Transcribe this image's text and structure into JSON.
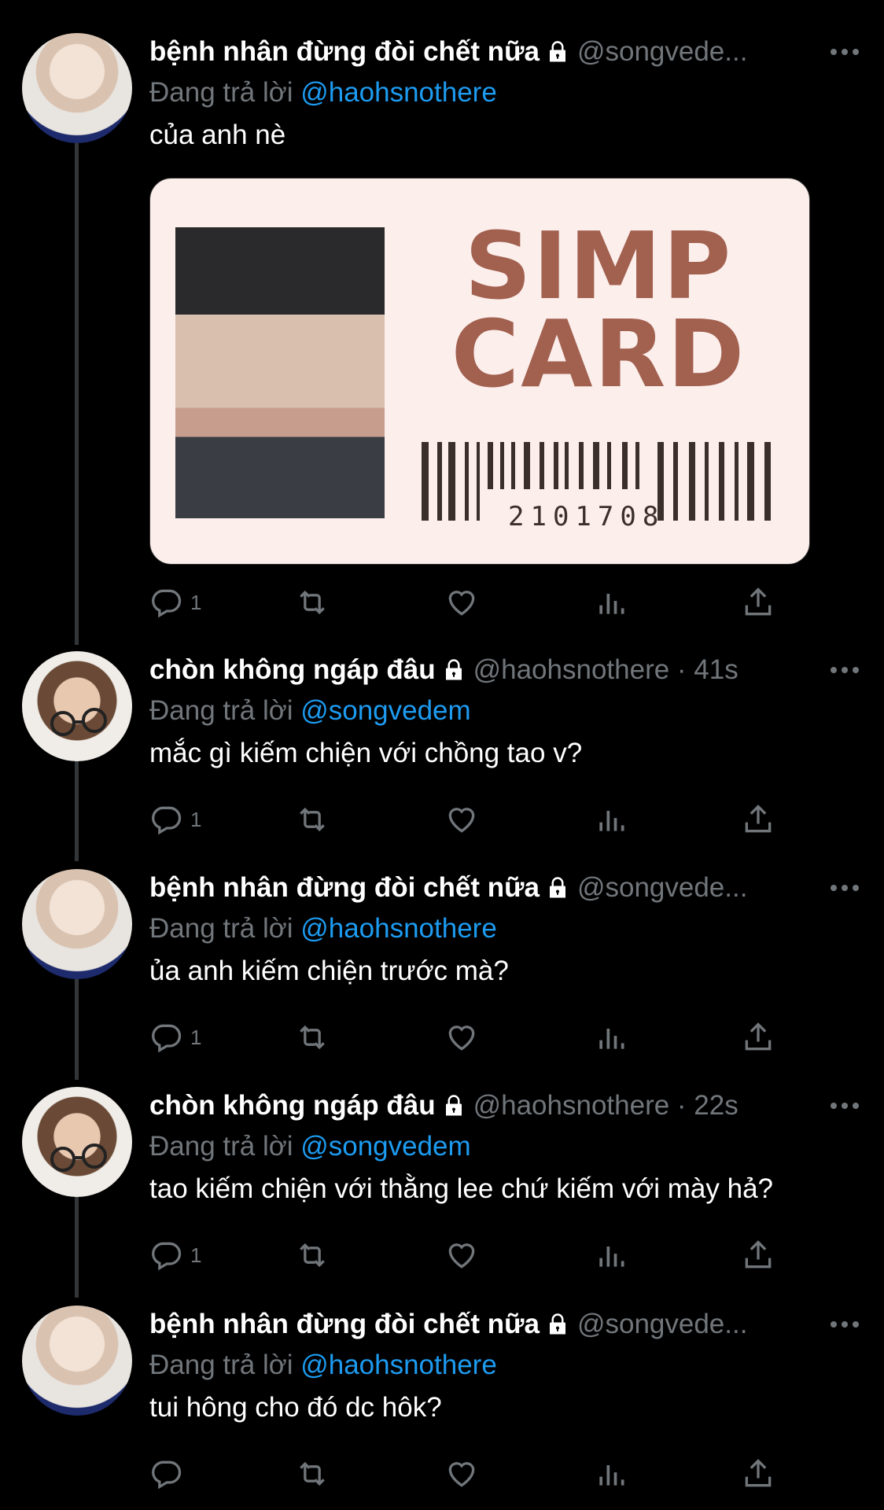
{
  "reply_prefix": "Đang trả lời",
  "tweets": [
    {
      "name": "bệnh nhân đừng đòi chết nữa",
      "handle": "@songvede...",
      "reply_to": "@haohsnothere",
      "text": "của anh nè",
      "replies": "1",
      "avatar": "avatar-blonde",
      "media": {
        "title_line1": "SIMP",
        "title_line2": "CARD",
        "barcode_number": "2101708"
      }
    },
    {
      "name": "chòn không ngáp đâu",
      "handle": "@haohsnothere · 41s",
      "reply_to": "@songvedem",
      "text": "mắc gì kiếm chiện với chồng tao v?",
      "replies": "1",
      "avatar": "avatar-glasses"
    },
    {
      "name": "bệnh nhân đừng đòi chết nữa",
      "handle": "@songvede...",
      "reply_to": "@haohsnothere",
      "text": "ủa anh kiếm chiện trước mà?",
      "replies": "1",
      "avatar": "avatar-blonde"
    },
    {
      "name": "chòn không ngáp đâu",
      "handle": "@haohsnothere · 22s",
      "reply_to": "@songvedem",
      "text": "tao kiếm chiện với thằng lee chứ kiếm với mày hả?",
      "replies": "1",
      "avatar": "avatar-glasses"
    },
    {
      "name": "bệnh nhân đừng đòi chết nữa",
      "handle": "@songvede...",
      "reply_to": "@haohsnothere",
      "text": "tui hông cho đó dc hôk?",
      "replies": "",
      "avatar": "avatar-blonde"
    }
  ],
  "icons": {
    "reply": "reply-icon",
    "retweet": "retweet-icon",
    "like": "heart-icon",
    "views": "views-icon",
    "share": "share-icon",
    "more": "more-icon",
    "lock": "lock-icon"
  },
  "colors": {
    "background": "#000000",
    "mention": "#1d9bf0",
    "secondary": "#71767b",
    "card_bg": "#fbeeeb",
    "card_title": "#a2604f"
  }
}
